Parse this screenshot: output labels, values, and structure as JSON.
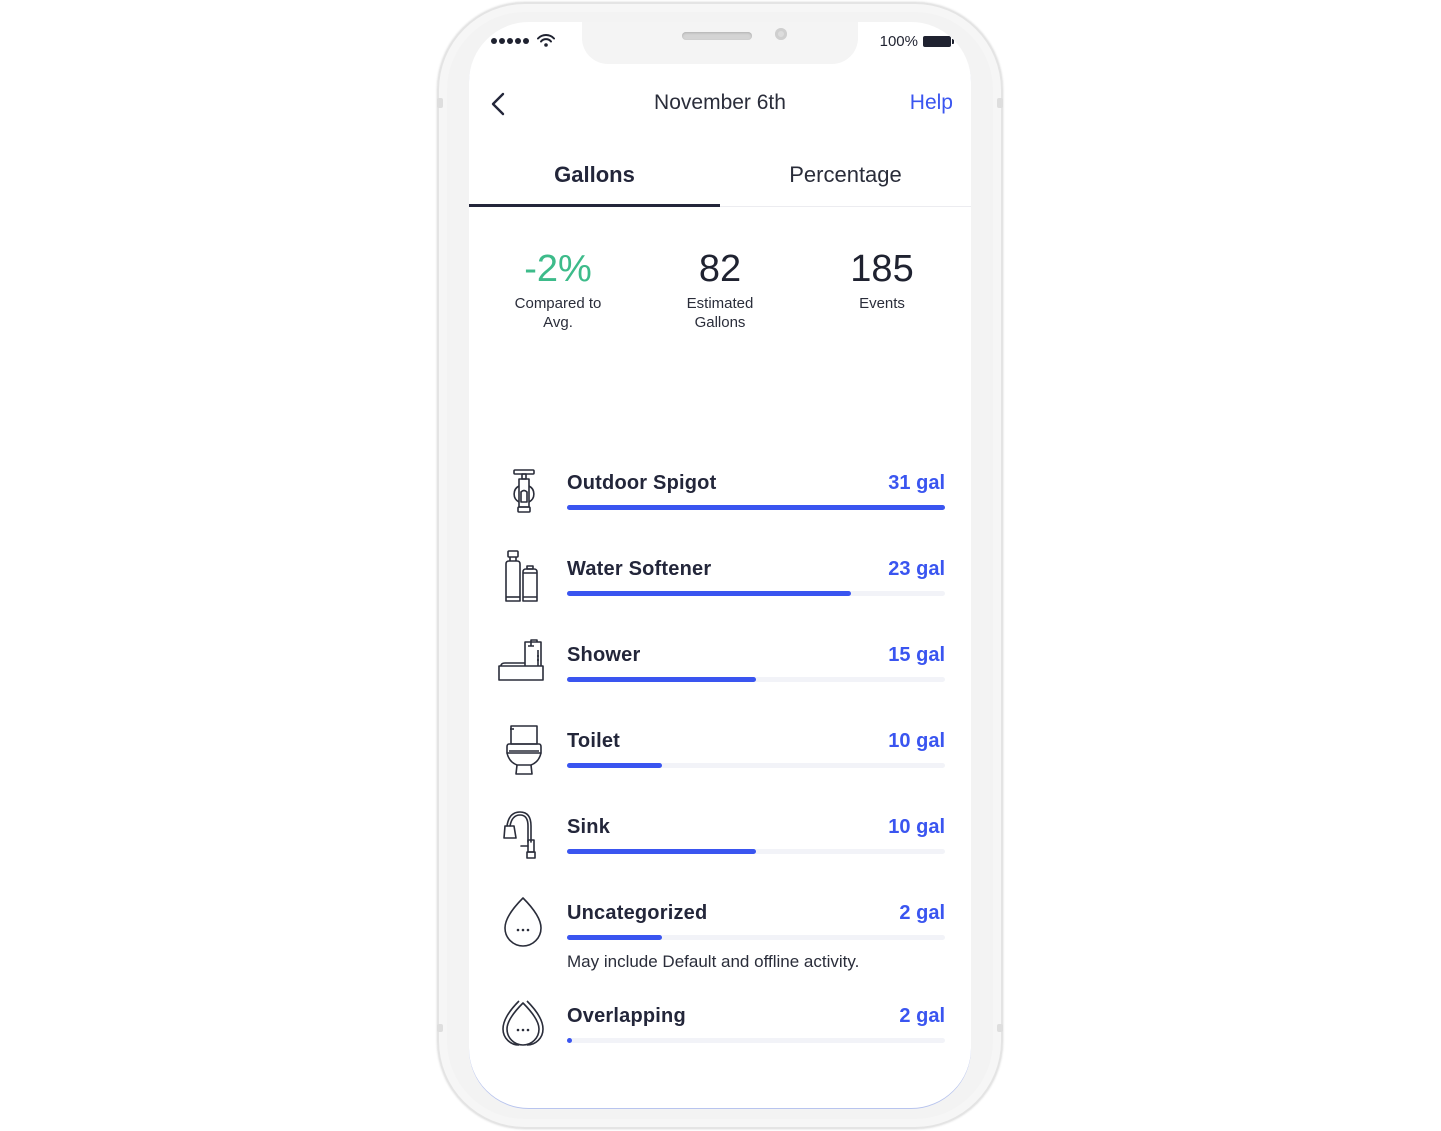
{
  "status_bar": {
    "signal_dots": 5,
    "wifi_icon": "wifi-icon",
    "battery_text": "100%",
    "battery_icon": "battery-icon"
  },
  "nav": {
    "back_icon": "chevron-left-icon",
    "title": "November 6th",
    "help_label": "Help"
  },
  "tabs": [
    {
      "label": "Gallons",
      "active": true
    },
    {
      "label": "Percentage",
      "active": false
    }
  ],
  "stats": [
    {
      "value": "-2%",
      "label": "Compared to Avg.",
      "color": "#3dbb8a"
    },
    {
      "value": "82",
      "label": "Estimated Gallons"
    },
    {
      "value": "185",
      "label": "Events"
    }
  ],
  "colors": {
    "accent": "#3a55f0",
    "positive": "#3dbb8a",
    "text_dark": "#23263a",
    "track": "#f2f3f8"
  },
  "usage": [
    {
      "name": "Outdoor Spigot",
      "value": "31 gal",
      "gallons": 31,
      "fill_fraction": 1.0,
      "icon": "spigot-icon"
    },
    {
      "name": "Water Softener",
      "value": "23 gal",
      "gallons": 23,
      "fill_fraction": 0.75,
      "icon": "water-softener-icon"
    },
    {
      "name": "Shower",
      "value": "15 gal",
      "gallons": 15,
      "fill_fraction": 0.5,
      "icon": "shower-icon"
    },
    {
      "name": "Toilet",
      "value": "10 gal",
      "gallons": 10,
      "fill_fraction": 0.25,
      "icon": "toilet-icon"
    },
    {
      "name": "Sink",
      "value": "10 gal",
      "gallons": 10,
      "fill_fraction": 0.5,
      "icon": "sink-faucet-icon"
    },
    {
      "name": "Uncategorized",
      "value": "2 gal",
      "gallons": 2,
      "fill_fraction": 0.25,
      "icon": "water-drop-ellipsis-icon",
      "note": "May include Default and offline activity."
    },
    {
      "name": "Overlapping",
      "value": "2 gal",
      "gallons": 2,
      "fill_fraction": 0.01,
      "icon": "overlapping-drops-icon"
    }
  ]
}
